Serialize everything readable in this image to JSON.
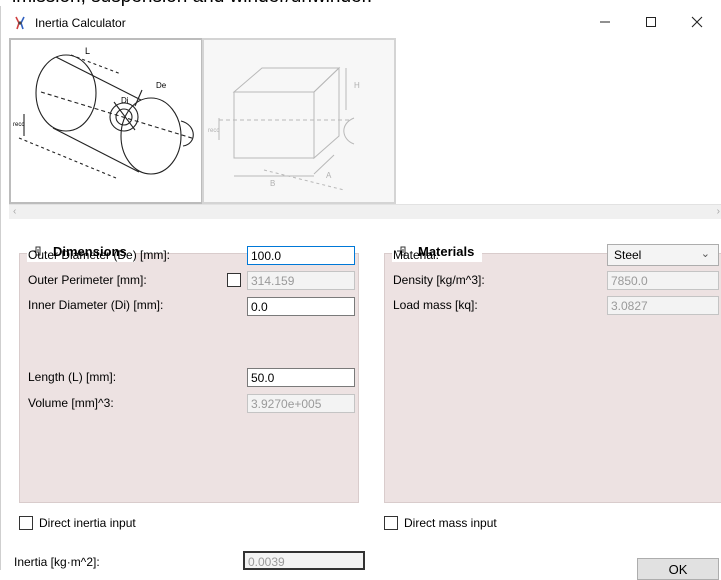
{
  "background_text": "lmission, suspension and winder/unwinder.",
  "window": {
    "title": "Inertia Calculator",
    "controls": {
      "minimize": "–",
      "maximize": "☐",
      "close": "✕"
    }
  },
  "images": {
    "cylinder_labels": {
      "L": "L",
      "Di": "Di",
      "De": "De",
      "recc": "recc"
    },
    "box_labels": {
      "H": "H",
      "B": "B",
      "A": "A",
      "recc": "recc"
    }
  },
  "dimensions": {
    "header": "Dimensions",
    "outer_diameter": {
      "label": "Outer Diameter (De) [mm]:",
      "value": "100.0"
    },
    "outer_perimeter": {
      "label": "Outer Perimeter [mm]:",
      "value": "314.159",
      "checked": false
    },
    "inner_diameter": {
      "label": "Inner Diameter (Di) [mm]:",
      "value": "0.0"
    },
    "length": {
      "label": "Length (L) [mm]:",
      "value": "50.0"
    },
    "volume": {
      "label": "Volume [mm]^3:",
      "value": "3.9270e+005"
    }
  },
  "materials": {
    "header": "Materials",
    "material": {
      "label": "Material:",
      "value": "Steel"
    },
    "density": {
      "label": "Density [kg/m^3]:",
      "value": "7850.0"
    },
    "load_mass": {
      "label": "Load mass [kq]:",
      "value": "3.0827"
    }
  },
  "direct_inertia": {
    "label": "Direct inertia input",
    "checked": false
  },
  "direct_mass": {
    "label": "Direct mass input",
    "checked": false
  },
  "inertia": {
    "label": "Inertia [kg·m^2]:",
    "value": "0.0039"
  },
  "ok_label": "OK",
  "colors": {
    "group_background": "#ede2e2",
    "focus_border": "#0078d7"
  }
}
